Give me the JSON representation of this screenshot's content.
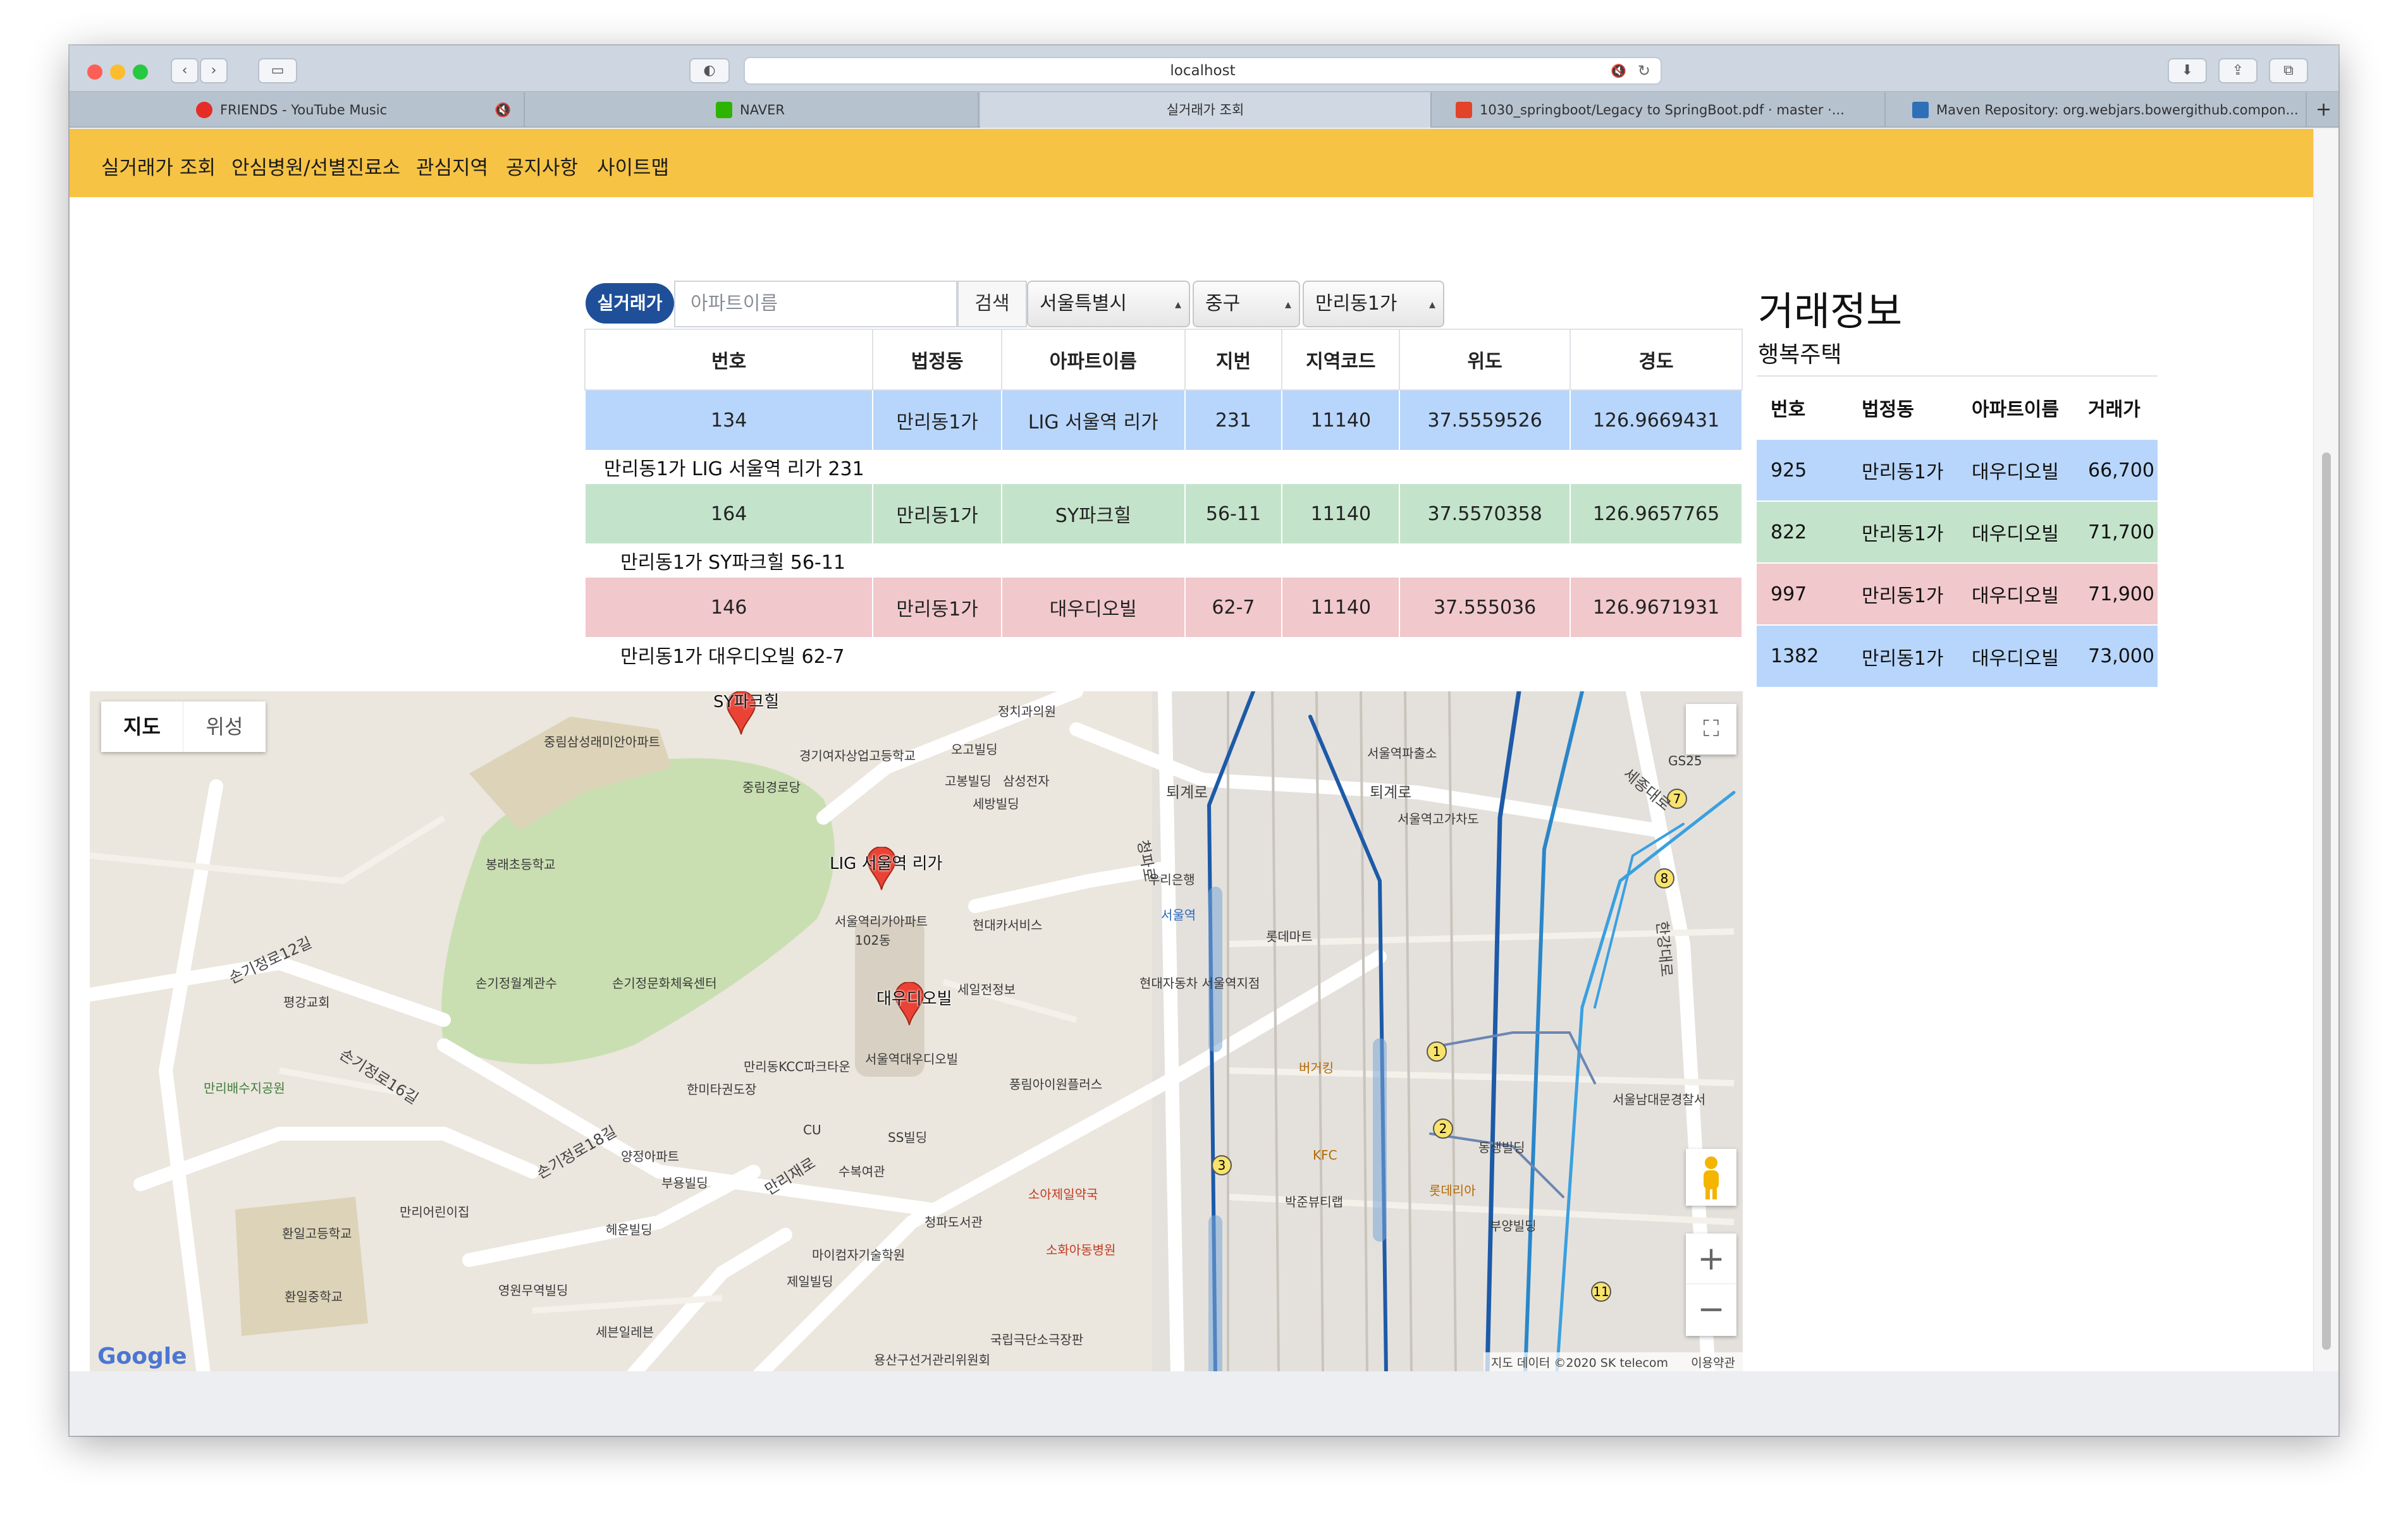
{
  "browser": {
    "url": "localhost",
    "tabs": [
      {
        "label": "FRIENDS - YouTube Music",
        "icon": "youtube-music-icon",
        "muted": true
      },
      {
        "label": "NAVER",
        "icon": "naver-icon"
      },
      {
        "label": "실거래가 조회",
        "active": true
      },
      {
        "label": "1030_springboot/Legacy to SpringBoot.pdf · master ·...",
        "icon": "gitlab-icon"
      },
      {
        "label": "Maven Repository: org.webjars.bowergithub.compon...",
        "icon": "mvn-icon"
      }
    ],
    "new_tab_label": "+"
  },
  "nav": {
    "items": [
      "실거래가 조회",
      "안심병원/선별진료소",
      "관심지역",
      "공지사항",
      "사이트맵"
    ],
    "color": "#f6c344"
  },
  "search": {
    "badge": "실거래가",
    "placeholder": "아파트이름",
    "button": "검색",
    "city": "서울특별시",
    "district": "중구",
    "dong": "만리동1가"
  },
  "apt_table": {
    "headers": [
      "번호",
      "법정동",
      "아파트이름",
      "지번",
      "지역코드",
      "위도",
      "경도"
    ],
    "rows": [
      {
        "no": "134",
        "dong": "만리동1가",
        "name": "LIG 서울역 리가",
        "jibun": "231",
        "code": "11140",
        "lat": "37.5559526",
        "lng": "126.9669431",
        "addr": "만리동1가 LIG 서울역 리가 231",
        "color": "#b8d6fb"
      },
      {
        "no": "164",
        "dong": "만리동1가",
        "name": "SY파크힐",
        "jibun": "56-11",
        "code": "11140",
        "lat": "37.5570358",
        "lng": "126.9657765",
        "addr": "만리동1가 SY파크힐 56-11",
        "color": "#c4e3cb"
      },
      {
        "no": "146",
        "dong": "만리동1가",
        "name": "대우디오빌",
        "jibun": "62-7",
        "code": "11140",
        "lat": "37.555036",
        "lng": "126.9671931",
        "addr": "만리동1가 대우디오빌 62-7",
        "color": "#f1c8cb"
      }
    ]
  },
  "deal": {
    "title": "거래정보",
    "subtitle": "행복주택",
    "headers": [
      "번호",
      "법정동",
      "아파트이름",
      "거래가"
    ],
    "rows": [
      {
        "no": "925",
        "dong": "만리동1가",
        "name": "대우디오빌",
        "price": "66,700",
        "color": "#b8d6fb"
      },
      {
        "no": "822",
        "dong": "만리동1가",
        "name": "대우디오빌",
        "price": "71,700",
        "color": "#c4e3cb"
      },
      {
        "no": "997",
        "dong": "만리동1가",
        "name": "대우디오빌",
        "price": "71,900",
        "color": "#f1c8cb"
      },
      {
        "no": "1382",
        "dong": "만리동1가",
        "name": "대우디오빌",
        "price": "73,000",
        "color": "#b8d6fb"
      }
    ]
  },
  "map": {
    "type_buttons": [
      "지도",
      "위성"
    ],
    "markers": [
      "SY파크힐",
      "LIG 서울역 리가",
      "대우디오빌"
    ],
    "zoom_in": "+",
    "zoom_out": "−",
    "logo": "Google",
    "attribution": "지도 데이터 ©2020 SK telecom",
    "terms": "이용약관",
    "labels": [
      "중림삼성래미안아파트",
      "경기여자상업고등학교",
      "중림경로당",
      "봉래초등학교",
      "서울역리가아파트",
      "102동",
      "현대카서비스",
      "손기정월계관수",
      "손기정문화체육센터",
      "평강교회",
      "만리동KCC파크타운",
      "서울역대우디오빌",
      "만리배수지공원",
      "한미타권도장",
      "CU",
      "SS빌딩",
      "양정아파트",
      "부용빌딩",
      "수복여관",
      "만리어린이집",
      "헤운빌딩",
      "청파도서관",
      "환일고등학교",
      "환일중학교",
      "마이컴자기술학원",
      "제일빌딩",
      "영원무역빌딩",
      "세븐일레븐",
      "용산구선거관리위원회",
      "국립극단소극장판",
      "우리은행",
      "서울역",
      "롯데마트",
      "현대자동차 서울역지점",
      "버거킹",
      "KFC",
      "박준뷰티랩",
      "서울역파출소",
      "서울역고가차도",
      "GS25",
      "소화아동병원",
      "소아제일약국",
      "풍림아이원플러스",
      "정치과의원",
      "오고빌딩",
      "고봉빌딩",
      "삼성전자",
      "세방빌딩",
      "세일전정보",
      "서울남대문경찰서",
      "동생빌딩",
      "부양빌딩",
      "롯데리아",
      "퇴계로",
      "만리재로",
      "손기정로12길",
      "손기정로16길",
      "손기정로18길",
      "청파로",
      "한강대로",
      "세종대로"
    ]
  }
}
